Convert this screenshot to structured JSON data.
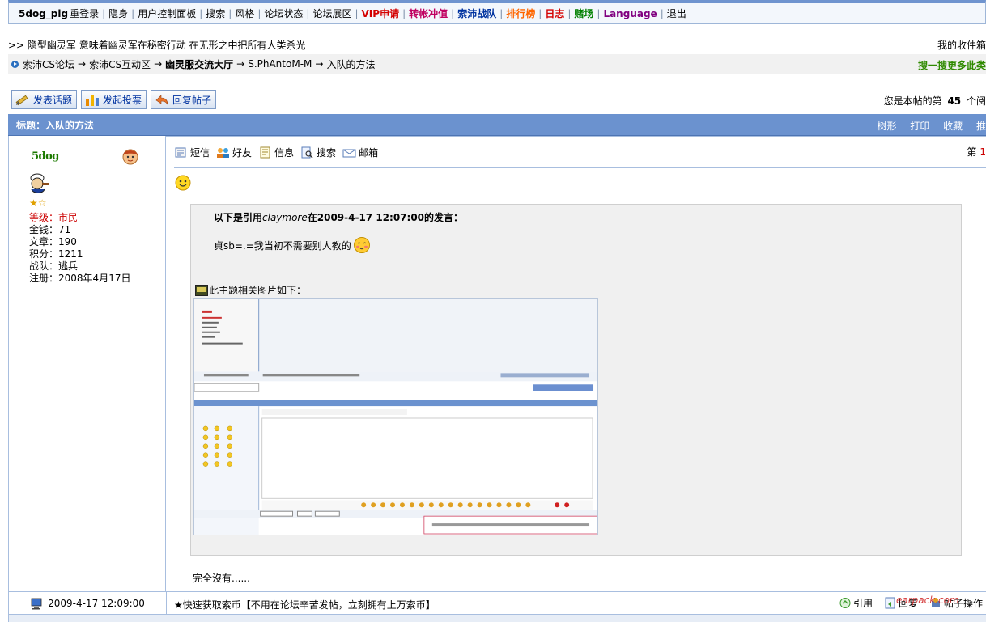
{
  "topnav": {
    "username": "5dog_pig",
    "items": [
      {
        "label": "重登录",
        "color": "#000000"
      },
      {
        "label": "隐身",
        "color": "#000000"
      },
      {
        "label": "用户控制面板",
        "color": "#000000"
      },
      {
        "label": "搜索",
        "color": "#000000"
      },
      {
        "label": "风格",
        "color": "#000000"
      },
      {
        "label": "论坛状态",
        "color": "#000000"
      },
      {
        "label": "论坛展区",
        "color": "#000000"
      },
      {
        "label": "VIP申请",
        "color": "#d40000"
      },
      {
        "label": "转帐冲值",
        "color": "#c00060"
      },
      {
        "label": "索沛战队",
        "color": "#0033a0"
      },
      {
        "label": "排行榜",
        "color": "#ff6600"
      },
      {
        "label": "日志",
        "color": "#d40000"
      },
      {
        "label": "赌场",
        "color": "#008000"
      },
      {
        "label": "Language",
        "color": "#800080"
      },
      {
        "label": "退出",
        "color": "#000000"
      }
    ]
  },
  "announcement": ">> 隐型幽灵军 意味着幽灵军在秘密行动 在无形之中把所有人类杀光",
  "inbox_text": "我的收件箱",
  "breadcrumb": {
    "parts": [
      "索沛CS论坛",
      "索沛CS互动区",
      "幽灵服交流大厅",
      "S.PhAntoM-M",
      "入队的方法"
    ],
    "arrow": "→",
    "search_more": "搜一搜更多此类"
  },
  "actions": {
    "new_topic": "发表话题",
    "new_poll": "发起投票",
    "reply": "回复帖子"
  },
  "post_count_text": {
    "prefix": "您是本帖的第",
    "number": "45",
    "suffix": "个阅"
  },
  "topic": {
    "title": "标题：入队的方法",
    "tools": [
      "树形",
      "打印",
      "收藏",
      "推"
    ]
  },
  "author": {
    "name": "5dog",
    "stars": "★☆",
    "stats": [
      {
        "label": "等级：",
        "value": "市民",
        "highlight": true
      },
      {
        "label": "金钱：",
        "value": "71",
        "highlight": false
      },
      {
        "label": "文章：",
        "value": "190",
        "highlight": false
      },
      {
        "label": "积分：",
        "value": "1211",
        "highlight": false
      },
      {
        "label": "战队：",
        "value": "逃兵",
        "highlight": false
      },
      {
        "label": "注册：",
        "value": "2008年4月17日",
        "highlight": false
      }
    ]
  },
  "post_icons": [
    {
      "label": "短信",
      "icon": "message-icon"
    },
    {
      "label": "好友",
      "icon": "friends-icon"
    },
    {
      "label": "信息",
      "icon": "info-icon"
    },
    {
      "label": "搜索",
      "icon": "search-icon"
    },
    {
      "label": "邮箱",
      "icon": "mail-icon"
    }
  ],
  "floor": {
    "prefix": "第",
    "number": "1"
  },
  "quote": {
    "head_prefix": "以下是引用",
    "head_user": "claymore",
    "head_suffix": "在2009-4-17 12:07:00的发言：",
    "text": "貞sb=.=我当初不需要别人教的"
  },
  "attachment_label": "此主题相关图片如下：",
  "post_end": "完全沒有......",
  "footer": {
    "date": "2009-4-17 12:09:00",
    "promo": "★快速获取索币【不用在论坛辛苦发帖，立刻拥有上万索币】",
    "quote_btn": "引用",
    "reply_btn": "回复",
    "ops_btn": "帖子操作"
  },
  "watermark": "earpack.com",
  "colors": {
    "title_bar": "#6b92cf",
    "border": "#a8bedf",
    "link_blue": "#0033a0",
    "green": "#2f8a00"
  }
}
